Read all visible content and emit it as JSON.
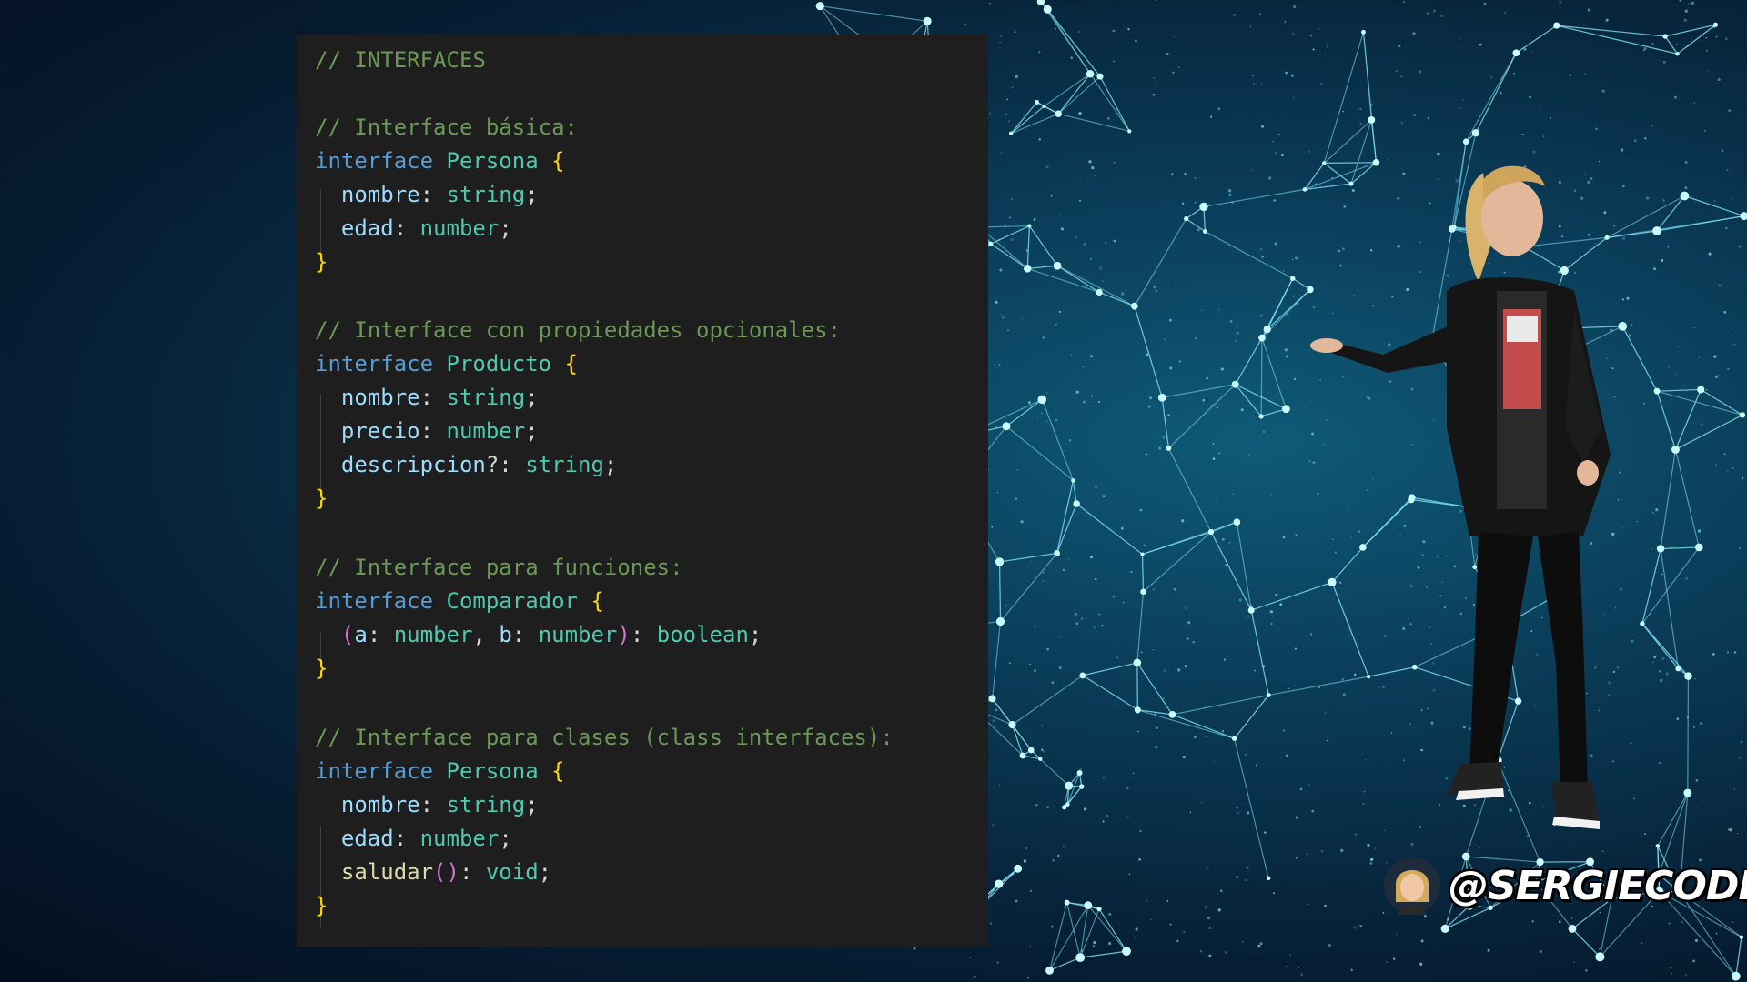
{
  "code": {
    "lines": [
      "// INTERFACES",
      "",
      "// Interface básica:",
      "interface Persona {",
      "  nombre: string;",
      "  edad: number;",
      "}",
      "",
      "// Interface con propiedades opcionales:",
      "interface Producto {",
      "  nombre: string;",
      "  precio: number;",
      "  descripcion?: string;",
      "}",
      "",
      "// Interface para funciones:",
      "interface Comparador {",
      "  (a: number, b: number): boolean;",
      "}",
      "",
      "// Interface para clases (class interfaces):",
      "interface Persona {",
      "  nombre: string;",
      "  edad: number;",
      "  saludar(): void;",
      "}"
    ]
  },
  "brand": {
    "handle": "@SERGIECODE"
  },
  "colors": {
    "comment": "#6a9955",
    "keyword": "#569cd6",
    "type": "#4ec9b0",
    "brace": "#ffd700",
    "property": "#9cdcfe",
    "paren": "#da70d6",
    "background_panel": "#1e1e1e"
  },
  "icons": {
    "avatar": "avatar-icon",
    "presenter": "presenter-figure"
  }
}
